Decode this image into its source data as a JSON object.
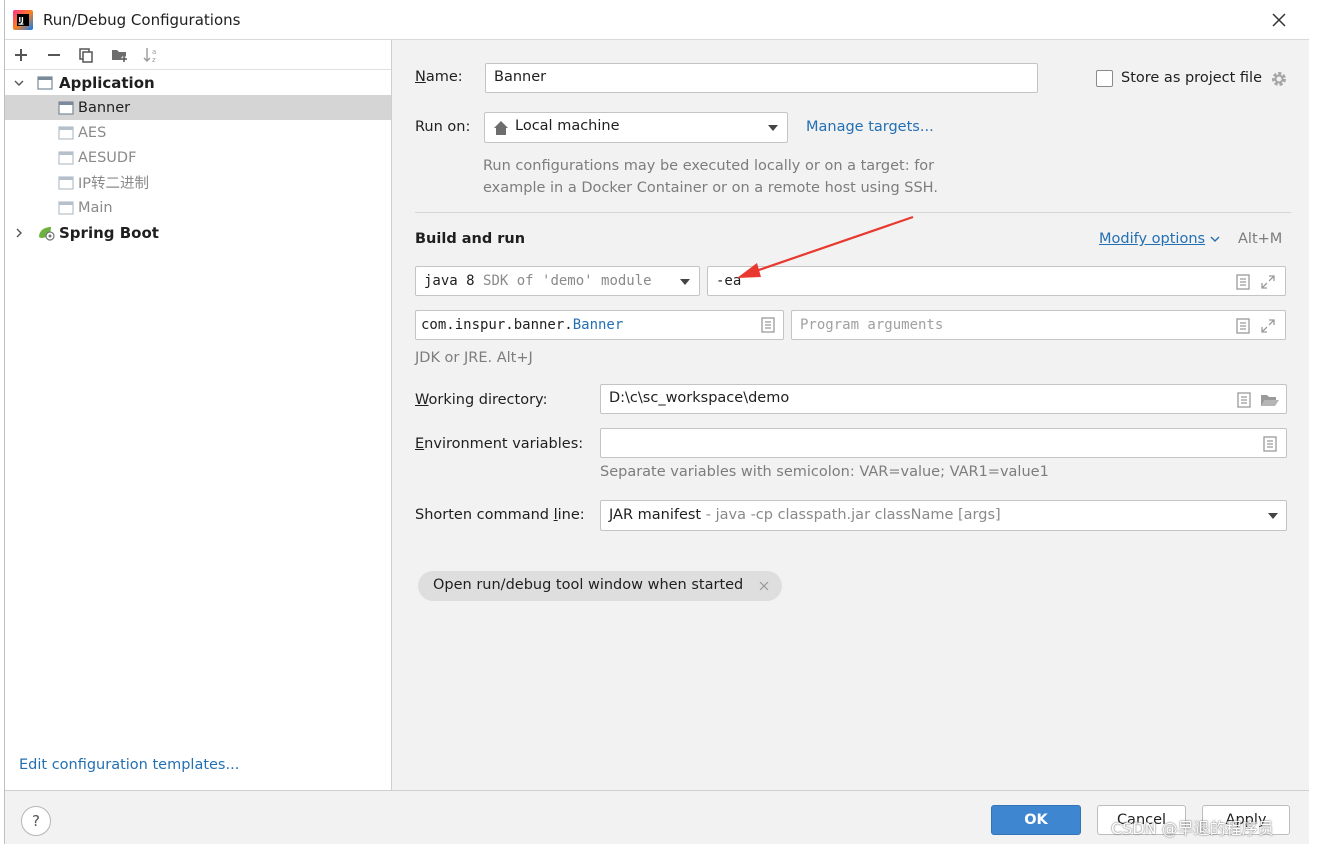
{
  "window": {
    "title": "Run/Debug Configurations"
  },
  "toolbar": {
    "icons": [
      "plus-icon",
      "minus-icon",
      "copy-icon",
      "folder-add-icon",
      "sort-icon"
    ]
  },
  "tree": {
    "groups": [
      {
        "label": "Application",
        "expanded": true,
        "items": [
          {
            "label": "Banner",
            "selected": true
          },
          {
            "label": "AES"
          },
          {
            "label": "AESUDF"
          },
          {
            "label": "IP转二进制"
          },
          {
            "label": "Main"
          }
        ]
      },
      {
        "label": "Spring Boot",
        "expanded": false
      }
    ]
  },
  "left_footer": {
    "templates_link": "Edit configuration templates..."
  },
  "form": {
    "name_label": "Name:",
    "name_value": "Banner",
    "store_label": "Store as project file",
    "run_on_label": "Run on:",
    "run_on_value": "Local machine",
    "manage_targets": "Manage targets...",
    "run_on_hint_line1": "Run configurations may be executed locally or on a target: for",
    "run_on_hint_line2": "example in a Docker Container or on a remote host using SSH.",
    "section_title": "Build and run",
    "modify_options": "Modify options",
    "modify_shortcut": "Alt+M",
    "jre_primary": "java 8",
    "jre_secondary": "SDK of 'demo' module",
    "vm_options_value": "-ea",
    "main_class_prefix": "com.inspur.banner.",
    "main_class_name": "Banner",
    "program_args_placeholder": "Program arguments",
    "jre_hint": "JDK or JRE. Alt+J",
    "workdir_label": "Working directory:",
    "workdir_value": "D:\\c\\sc_workspace\\demo",
    "env_label": "Environment variables:",
    "env_value": "",
    "env_hint": "Separate variables with semicolon: VAR=value; VAR1=value1",
    "shorten_label": "Shorten command line:",
    "shorten_value": "JAR manifest",
    "shorten_detail": " - java -cp classpath.jar className [args]",
    "chip_label": "Open run/debug tool window when started"
  },
  "buttons": {
    "ok": "OK",
    "cancel": "Cancel",
    "apply": "Apply",
    "help": "?"
  },
  "watermark": "CSDN @早退的程序员",
  "colors": {
    "accent": "#2470b3",
    "ok_button": "#3f86d0",
    "selection": "#d5d5d5",
    "annotation_arrow": "#e8382f"
  }
}
